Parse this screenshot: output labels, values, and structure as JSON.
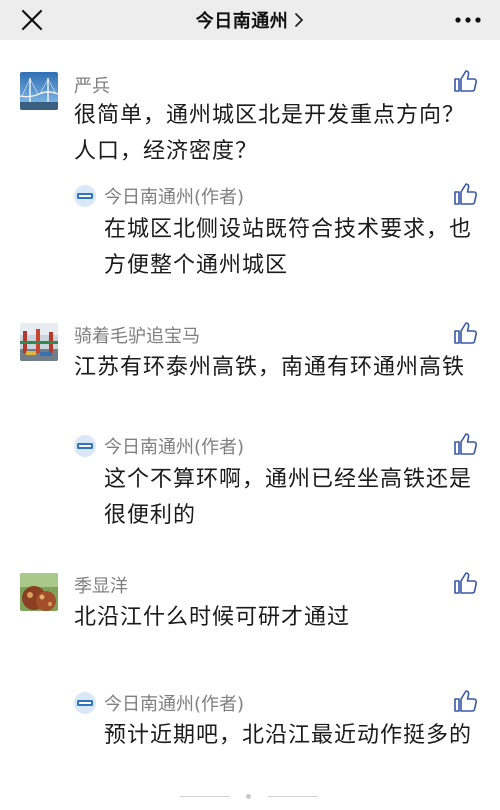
{
  "header": {
    "title": "今日南通州",
    "close_icon": "close-icon",
    "chevron_icon": "chevron-right-icon",
    "more_icon": "more-icon",
    "background": "#ededed"
  },
  "comments": [
    {
      "author": "严兵",
      "text": "很简单，通州城区北是开发重点方向？人口，经济密度？",
      "avatar_icon": "bridge-photo-icon",
      "like_icon": "thumbs-up-icon",
      "reply": {
        "author": "今日南通州(作者)",
        "text": "在城区北侧设站既符合技术要求，也方便整个通州城区",
        "logo_icon": "publisher-logo-icon",
        "like_icon": "thumbs-up-icon"
      }
    },
    {
      "author": "骑着毛驴追宝马",
      "text": "江苏有环泰州高铁，南通有环通州高铁",
      "avatar_icon": "harbor-photo-icon",
      "like_icon": "thumbs-up-icon",
      "reply": {
        "author": "今日南通州(作者)",
        "text": "这个不算环啊，通州已经坐高铁还是很便利的",
        "logo_icon": "publisher-logo-icon",
        "like_icon": "thumbs-up-icon"
      }
    },
    {
      "author": "季显洋",
      "text": "北沿江什么时候可研才通过",
      "avatar_icon": "food-photo-icon",
      "like_icon": "thumbs-up-icon",
      "reply": {
        "author": "今日南通州(作者)",
        "text": "预计近期吧，北沿江最近动作挺多的",
        "logo_icon": "publisher-logo-icon",
        "like_icon": "thumbs-up-icon"
      }
    }
  ],
  "colors": {
    "name": "#7f7f7f",
    "text": "#1b1b1b",
    "like_icon": "#3a57a7",
    "topbar": "#ededed"
  }
}
